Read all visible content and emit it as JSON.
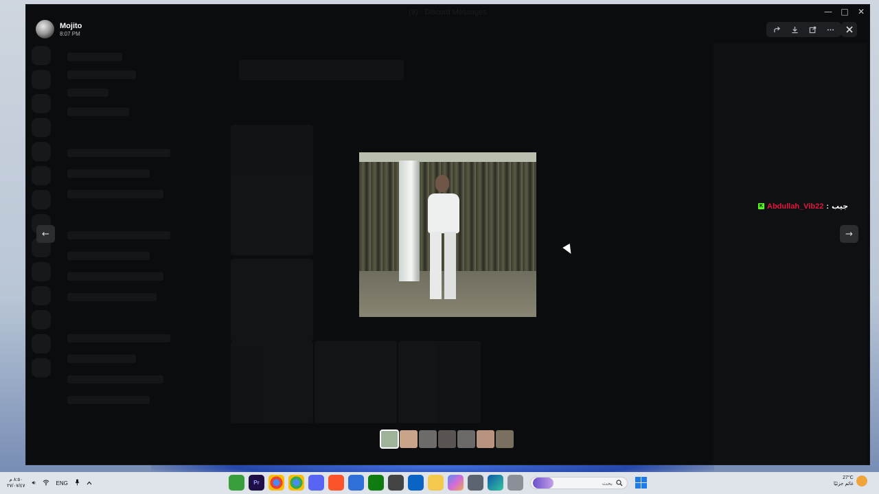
{
  "window": {
    "title": "(9) - Discord Messages",
    "controls": [
      "—",
      "□",
      "✕"
    ]
  },
  "user": {
    "name": "Mojito",
    "time": "8:07 PM"
  },
  "toolbar": {
    "forward_icon": "forward-icon",
    "download_icon": "download-icon",
    "open_external_icon": "external-link-icon",
    "more_icon": "more-icon",
    "close_icon": "close-icon"
  },
  "navigation": {
    "prev": "←",
    "next": "→"
  },
  "caption": {
    "kick_icon": "K",
    "username": "Abdullah_Vib22",
    "separator": " : ",
    "text": "جيب"
  },
  "thumbnails": {
    "count": 7,
    "active_index": 0,
    "colors": [
      "#9fb39a",
      "#c8a48a",
      "#6e6c6a",
      "#5a5552",
      "#6b6a68",
      "#b89380",
      "#7a7060"
    ]
  },
  "taskbar": {
    "time": "٨:٥٠ م",
    "date": "٢٧/٠٧/٤٧",
    "language": "ENG",
    "search_placeholder": "بحث",
    "weather_temp": "27°C",
    "weather_desc": "غائم جزئيًا"
  },
  "colors": {
    "accent_caption_user": "#e3163f",
    "kick_green": "#53fc18",
    "windows_blue": "#1e7ae6"
  }
}
